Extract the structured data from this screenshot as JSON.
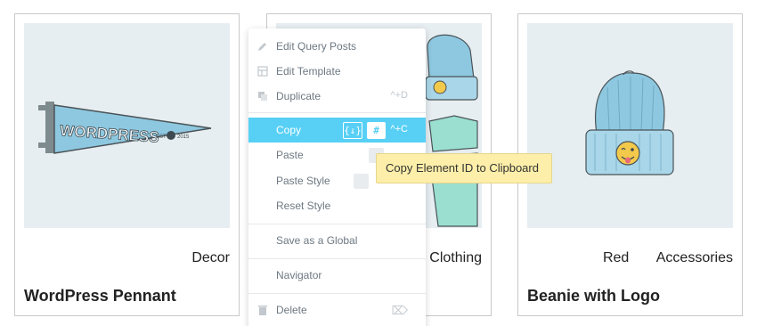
{
  "products": [
    {
      "categories": [
        "Decor"
      ],
      "title": "WordPress Pennant",
      "image": "wordpress-pennant"
    },
    {
      "categories": [
        "Clothing"
      ],
      "title": "",
      "image": "hoodie-beanie-tshirt"
    },
    {
      "categories": [
        "Red",
        "Accessories"
      ],
      "title": "Beanie with Logo",
      "image": "beanie-with-logo"
    }
  ],
  "pennant_text": "WORDPRESS",
  "pennant_small": "EST",
  "pennant_year": "2015",
  "context_menu": {
    "items": [
      {
        "label": "Edit Query Posts",
        "icon": "pencil-icon",
        "shortcut": ""
      },
      {
        "label": "Edit Template",
        "icon": "template-icon",
        "shortcut": ""
      },
      {
        "label": "Duplicate",
        "icon": "duplicate-icon",
        "shortcut": "^+D"
      },
      {
        "label": "Copy",
        "icon": "",
        "shortcut": "^+C",
        "active": true,
        "badge1": "{↓}",
        "badge2": "#"
      },
      {
        "label": "Paste",
        "icon": "",
        "shortcut": ""
      },
      {
        "label": "Paste Style",
        "icon": "",
        "shortcut": ""
      },
      {
        "label": "Reset Style",
        "icon": "",
        "shortcut": ""
      },
      {
        "label": "Save as a Global",
        "icon": "",
        "shortcut": ""
      },
      {
        "label": "Navigator",
        "icon": "",
        "shortcut": ""
      },
      {
        "label": "Delete",
        "icon": "trash-icon",
        "shortcut": "⌦"
      }
    ]
  },
  "tooltip": "Copy Element ID to Clipboard",
  "colors": {
    "accent": "#58d0f5",
    "tooltip_bg": "#fdefa9",
    "image_bg": "#e7eef2"
  }
}
